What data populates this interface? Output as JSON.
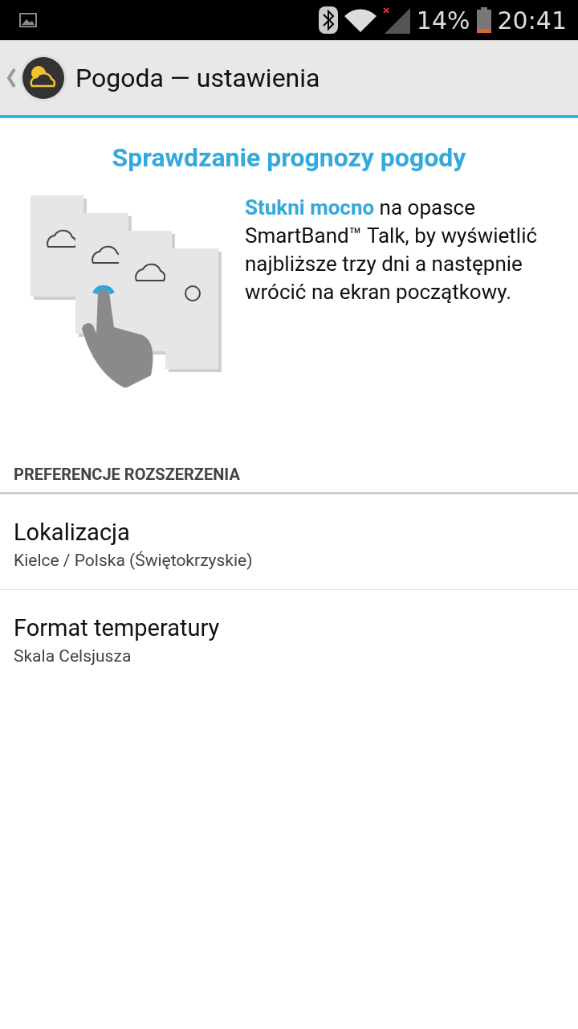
{
  "status_bar": {
    "battery": "14%",
    "time": "20:41"
  },
  "action_bar": {
    "title": "Pogoda — ustawienia"
  },
  "intro": {
    "heading": "Sprawdzanie prognozy pogody",
    "body": "**Stukni mocno** na opasce SmartBand™ Talk, by wyświetlić najbliższe trzy dni a następnie wrócić na ekran początkowy."
  },
  "section": {
    "title": "PREFERENCJE ROZSZERZENIA",
    "items": [
      {
        "title": "Lokalizacja",
        "summary": "Kielce / Polska (Świętokrzyskie)"
      },
      {
        "title": "Format temperatury",
        "summary": "Skala Celsjusza"
      }
    ]
  }
}
